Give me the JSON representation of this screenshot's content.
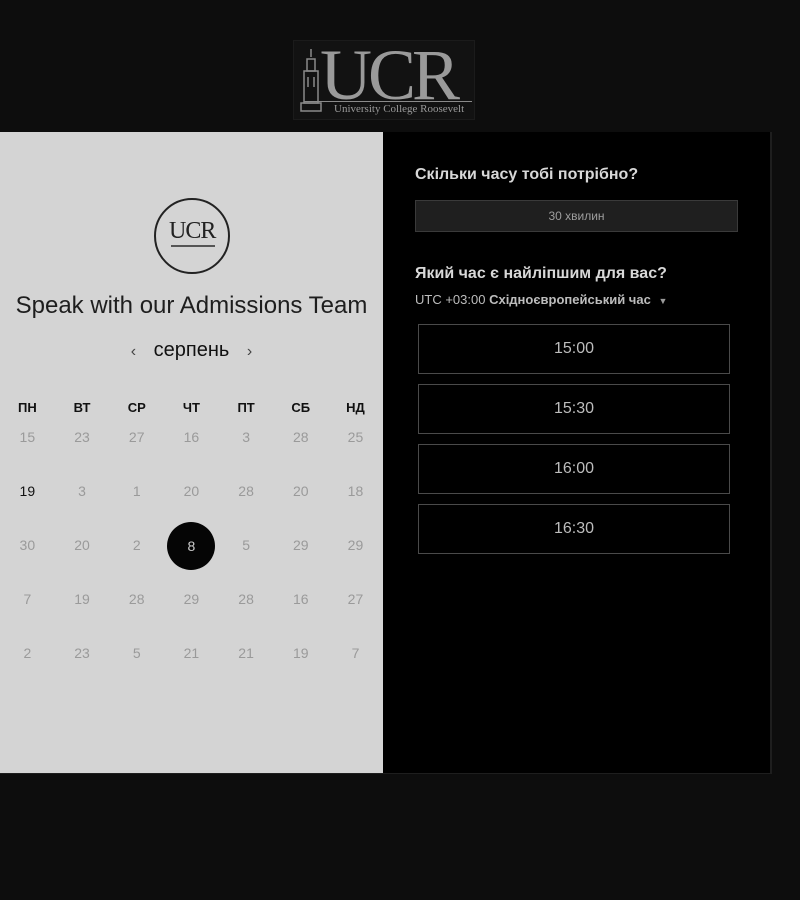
{
  "header": {
    "logo_letters": "UCR",
    "logo_caption": "University College Roosevelt"
  },
  "left_panel": {
    "seal_letters": "UCR",
    "headline": "Speak with our Admissions Team",
    "month": "серпень",
    "prev_icon": "chevron-left-icon",
    "next_icon": "chevron-right-icon",
    "weekdays": [
      "ПН",
      "ВТ",
      "СР",
      "ЧТ",
      "ПТ",
      "СБ",
      "НД"
    ],
    "weeks": [
      [
        "15",
        "23",
        "27",
        "16",
        "3",
        "28",
        "25"
      ],
      [
        "19",
        "3",
        "1",
        "20",
        "28",
        "20",
        "18"
      ],
      [
        "30",
        "20",
        "2",
        "8",
        "5",
        "29",
        "29"
      ],
      [
        "7",
        "19",
        "28",
        "29",
        "28",
        "16",
        "27"
      ],
      [
        "2",
        "23",
        "5",
        "21",
        "21",
        "19",
        "7"
      ]
    ],
    "selected_day": "8",
    "highlighted_day": "19"
  },
  "right_panel": {
    "duration_question": "Скільки часу тобі потрібно?",
    "duration_value": "30 хвилин",
    "time_question": "Який час є найліпшим для вас?",
    "timezone_offset": "UTC +03:00",
    "timezone_name": "Східноєвропейський час",
    "timezone_caret_icon": "caret-down-icon",
    "time_slots": [
      "15:00",
      "15:30",
      "16:00",
      "16:30"
    ]
  },
  "colors": {
    "page_bg": "#0d0d0d",
    "left_panel_bg": "#d4d4d4",
    "right_panel_bg": "#000000",
    "selected_day_bg": "#050505",
    "slot_border": "#4a4a4a"
  }
}
